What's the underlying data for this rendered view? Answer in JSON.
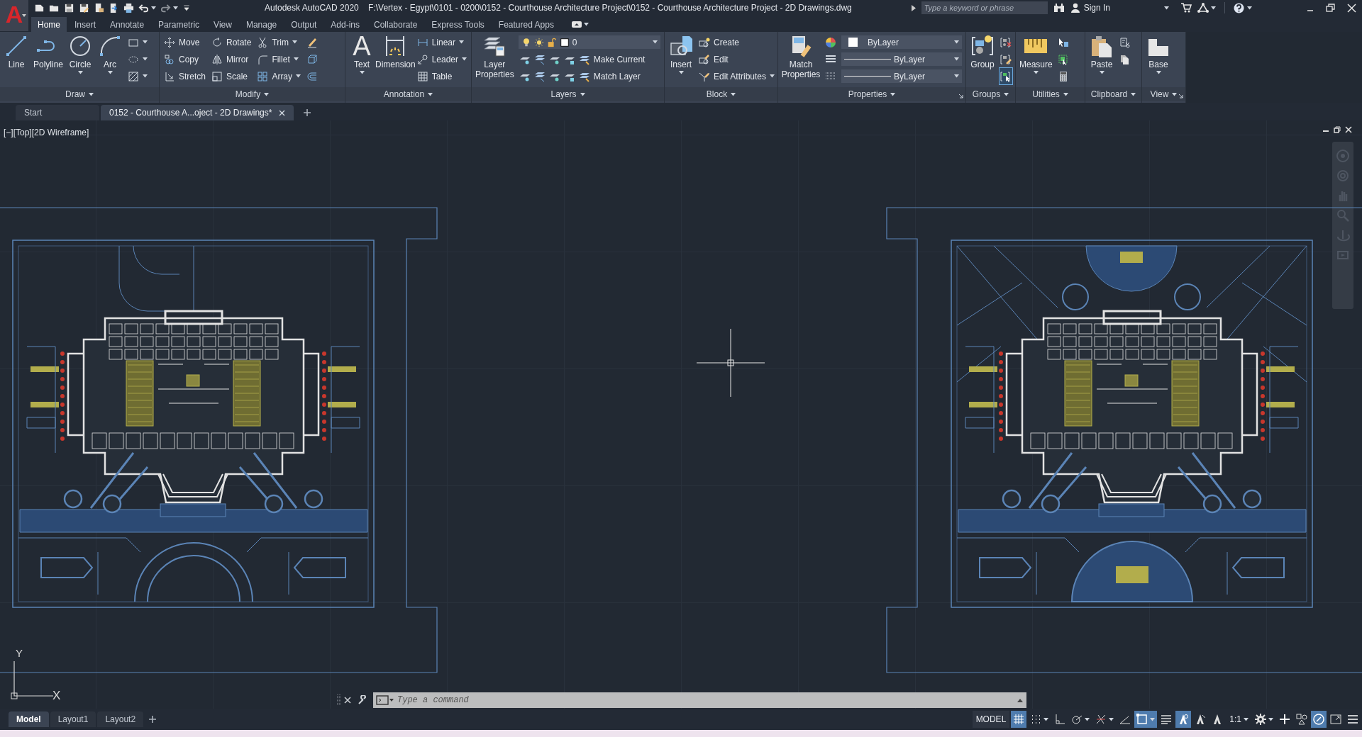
{
  "app_button": {
    "glyph": "A"
  },
  "title": {
    "app": "Autodesk AutoCAD 2020",
    "file": "F:\\Vertex - Egypt\\0101 - 0200\\0152 - Courthouse Architecture Project\\0152 - Courthouse Architecture Project - 2D Drawings.dwg"
  },
  "search": {
    "placeholder": "Type a keyword or phrase"
  },
  "sign_in": "Sign In",
  "ribbon_tabs": [
    {
      "label": "Home",
      "selected": true
    },
    {
      "label": "Insert",
      "selected": false
    },
    {
      "label": "Annotate",
      "selected": false
    },
    {
      "label": "Parametric",
      "selected": false
    },
    {
      "label": "View",
      "selected": false
    },
    {
      "label": "Manage",
      "selected": false
    },
    {
      "label": "Output",
      "selected": false
    },
    {
      "label": "Add-ins",
      "selected": false
    },
    {
      "label": "Collaborate",
      "selected": false
    },
    {
      "label": "Express Tools",
      "selected": false
    },
    {
      "label": "Featured Apps",
      "selected": false
    }
  ],
  "ribbon_panels": [
    {
      "title": "Draw",
      "launcher": false,
      "columns": [
        {
          "kind": "big",
          "tool": {
            "label": "Line",
            "dropdown": false
          }
        },
        {
          "kind": "big",
          "tool": {
            "label": "Polyline",
            "dropdown": false
          }
        },
        {
          "kind": "big",
          "tool": {
            "label": "Circle",
            "dropdown": true
          }
        },
        {
          "kind": "big",
          "tool": {
            "label": "Arc",
            "dropdown": true
          }
        },
        {
          "kind": "stack",
          "rows": [
            {
              "dropdown": true
            },
            {
              "dropdown": true
            },
            {
              "dropdown": true
            }
          ]
        }
      ]
    },
    {
      "title": "Modify",
      "launcher": false,
      "columns": [
        {
          "kind": "stack",
          "rows": [
            {
              "label": "Move",
              "dropdown": false
            },
            {
              "label": "Copy",
              "dropdown": false
            },
            {
              "label": "Stretch",
              "dropdown": false
            }
          ]
        },
        {
          "kind": "stack",
          "rows": [
            {
              "label": "Rotate",
              "dropdown": false
            },
            {
              "label": "Mirror",
              "dropdown": false
            },
            {
              "label": "Scale",
              "dropdown": false
            }
          ]
        },
        {
          "kind": "stack",
          "rows": [
            {
              "label": "Trim",
              "dropdown": true
            },
            {
              "label": "Fillet",
              "dropdown": true
            },
            {
              "label": "Array",
              "dropdown": true
            }
          ]
        },
        {
          "kind": "stack",
          "rows": [
            {
              "dropdown": false
            },
            {
              "dropdown": false
            },
            {
              "dropdown": false
            }
          ]
        }
      ]
    },
    {
      "title": "Annotation",
      "launcher": false,
      "columns": [
        {
          "kind": "big",
          "tool": {
            "label": "Text",
            "glyph": "A",
            "dropdown": true
          }
        },
        {
          "kind": "big",
          "tool": {
            "label": "Dimension",
            "dropdown": false
          }
        },
        {
          "kind": "stack",
          "rows": [
            {
              "label": "Linear",
              "dropdown": true
            },
            {
              "label": "Leader",
              "dropdown": true
            },
            {
              "label": "Table",
              "dropdown": false
            }
          ]
        }
      ]
    },
    {
      "title": "Layers",
      "launcher": false,
      "columns": [
        {
          "kind": "big",
          "tool": {
            "label": "Layer Properties",
            "dropdown": false
          }
        },
        {
          "kind": "stack",
          "rows": [
            {
              "kind": "layer_select",
              "value": "0"
            },
            {
              "label": "Make Current",
              "dropdown": false
            },
            {
              "label": "Match Layer",
              "dropdown": false
            }
          ]
        }
      ]
    },
    {
      "title": "Block",
      "launcher": false,
      "columns": [
        {
          "kind": "big",
          "tool": {
            "label": "Insert",
            "dropdown": true
          }
        },
        {
          "kind": "stack",
          "rows": [
            {
              "label": "Create",
              "dropdown": false
            },
            {
              "label": "Edit",
              "dropdown": false
            },
            {
              "label": "Edit Attributes",
              "dropdown": true
            }
          ]
        }
      ]
    },
    {
      "title": "Properties",
      "launcher": true,
      "columns": [
        {
          "kind": "big",
          "tool": {
            "label": "Match Properties",
            "dropdown": false
          }
        },
        {
          "kind": "stack",
          "rows": [
            {
              "dropdown": false
            },
            {
              "dropdown": false
            },
            {
              "dropdown": false
            }
          ]
        },
        {
          "kind": "stack",
          "rows": [
            {
              "kind": "color_select",
              "value": "ByLayer"
            },
            {
              "kind": "line_select",
              "value": "ByLayer"
            },
            {
              "kind": "line_select",
              "value": "ByLayer"
            }
          ]
        }
      ]
    },
    {
      "title": "Groups",
      "launcher": false,
      "columns": [
        {
          "kind": "big",
          "tool": {
            "label": "Group",
            "dropdown": false
          }
        },
        {
          "kind": "stack",
          "rows": [
            {
              "dropdown": false,
              "active": false
            },
            {
              "dropdown": false,
              "active": false
            },
            {
              "dropdown": false,
              "active": true
            }
          ]
        }
      ]
    },
    {
      "title": "Utilities",
      "launcher": false,
      "columns": [
        {
          "kind": "big",
          "tool": {
            "label": "Measure",
            "dropdown": true
          }
        },
        {
          "kind": "stack",
          "rows": [
            {
              "dropdown": false
            },
            {
              "dropdown": false
            },
            {
              "dropdown": false
            }
          ]
        }
      ]
    },
    {
      "title": "Clipboard",
      "launcher": false,
      "columns": [
        {
          "kind": "big",
          "tool": {
            "label": "Paste",
            "dropdown": true
          }
        },
        {
          "kind": "stack",
          "rows": [
            {
              "dropdown": false
            },
            {
              "dropdown": false
            }
          ]
        }
      ]
    },
    {
      "title": "View",
      "launcher": true,
      "columns": [
        {
          "kind": "big",
          "tool": {
            "label": "Base",
            "dropdown": true
          }
        }
      ]
    }
  ],
  "doc_tabs": [
    {
      "label": "Start",
      "selected": false,
      "closable": false
    },
    {
      "label": "0152 - Courthouse A...oject - 2D Drawings*",
      "selected": true,
      "closable": true
    }
  ],
  "viewport_label": "[−][Top][2D Wireframe]",
  "ucs": {
    "y_label": "Y",
    "x_label": "X"
  },
  "command_line": {
    "placeholder": "Type a command"
  },
  "layout_tabs": [
    {
      "label": "Model",
      "selected": true
    },
    {
      "label": "Layout1",
      "selected": false
    },
    {
      "label": "Layout2",
      "selected": false
    }
  ],
  "status_bar": [
    {
      "kind": "label",
      "label": "MODEL"
    },
    {
      "kind": "toggle",
      "on": true,
      "dropdown": false
    },
    {
      "kind": "toggle",
      "on": false,
      "dropdown": true
    },
    {
      "kind": "toggle",
      "on": false,
      "dropdown": false
    },
    {
      "kind": "toggle",
      "on": false,
      "dropdown": true
    },
    {
      "kind": "toggle",
      "on": false,
      "dropdown": true
    },
    {
      "kind": "toggle",
      "on": false,
      "dropdown": false
    },
    {
      "kind": "toggle",
      "on": true,
      "dropdown": true
    },
    {
      "kind": "toggle",
      "on": false,
      "dropdown": false
    },
    {
      "kind": "toggle",
      "on": true,
      "dropdown": false
    },
    {
      "kind": "toggle",
      "on": false,
      "dropdown": false
    },
    {
      "kind": "toggle",
      "on": false,
      "dropdown": false
    },
    {
      "kind": "scale",
      "label": "1:1",
      "dropdown": true
    },
    {
      "kind": "toggle",
      "on": false,
      "dropdown": true
    },
    {
      "kind": "toggle",
      "on": false,
      "dropdown": false
    },
    {
      "kind": "toggle",
      "on": false,
      "dropdown": false
    },
    {
      "kind": "toggle",
      "on": true,
      "dropdown": false
    },
    {
      "kind": "toggle",
      "on": false,
      "dropdown": false
    },
    {
      "kind": "toggle",
      "on": false,
      "dropdown": false
    }
  ]
}
